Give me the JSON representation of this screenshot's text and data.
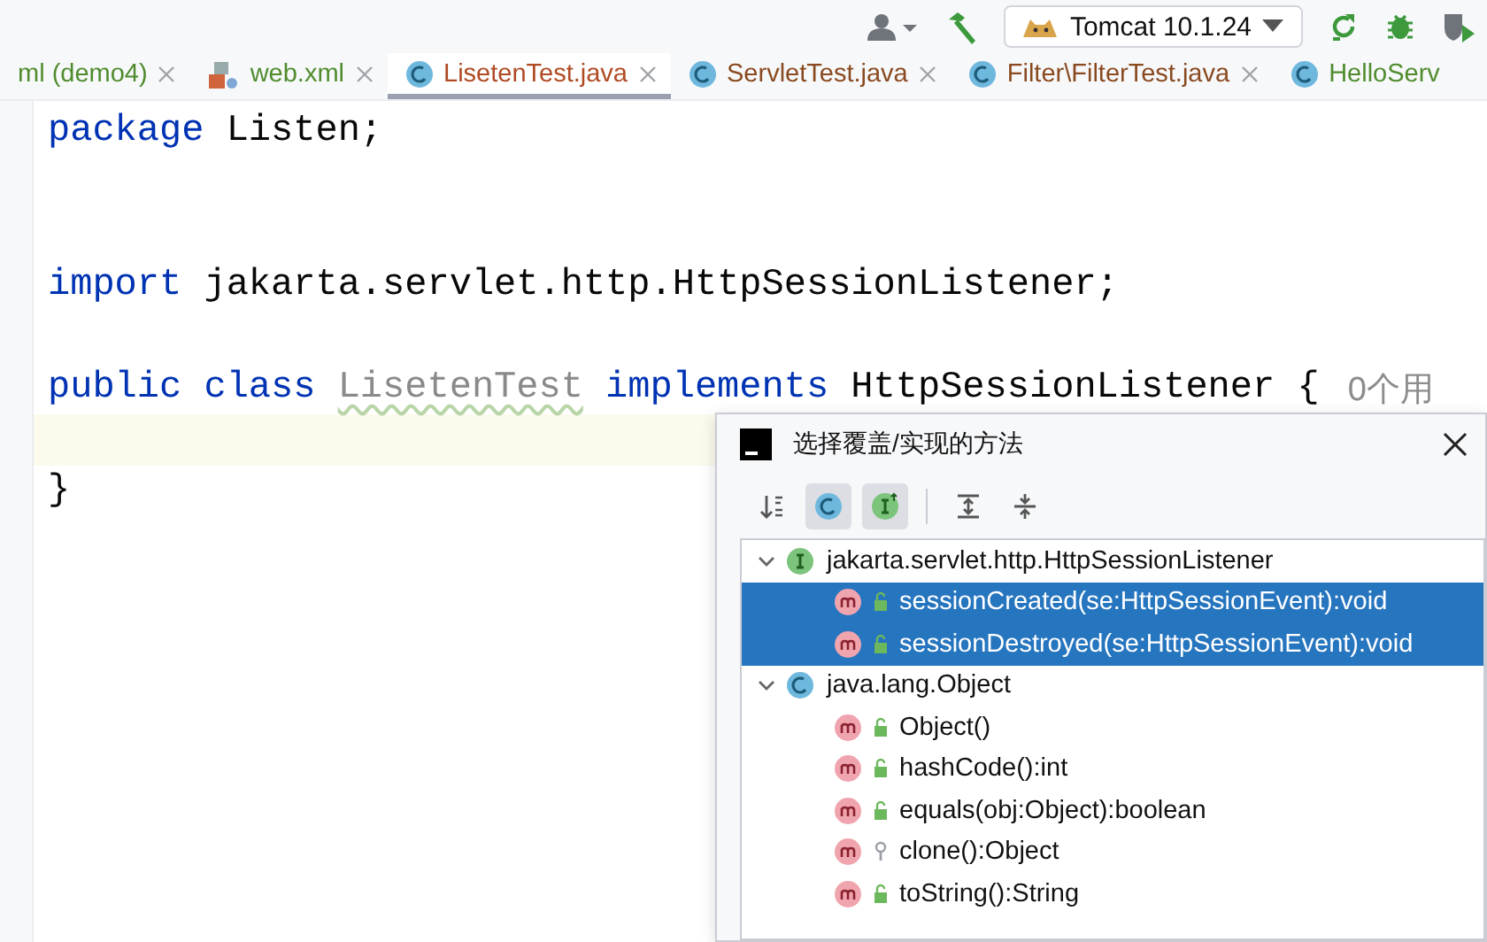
{
  "toolbar": {
    "run_config": "Tomcat 10.1.24"
  },
  "tabs": [
    {
      "label": "ml (demo4)",
      "kind": "xml-module",
      "color": "#508c2d",
      "selected": false
    },
    {
      "label": "web.xml",
      "kind": "xml",
      "color": "#508c2d",
      "selected": false
    },
    {
      "label": "LisetenTest.java",
      "kind": "class",
      "color": "#b04a24",
      "selected": true
    },
    {
      "label": "ServletTest.java",
      "kind": "class",
      "color": "#8a4a20",
      "selected": false
    },
    {
      "label": "Filter\\FilterTest.java",
      "kind": "class",
      "color": "#8a4a20",
      "selected": false
    },
    {
      "label": "HelloServ",
      "kind": "class",
      "color": "#508c2d",
      "selected": false
    }
  ],
  "editor": {
    "lines": [
      {
        "kind": "code",
        "tokens": [
          {
            "kind": "keyword",
            "text": "package"
          },
          {
            "kind": "plain",
            "text": "Listen;"
          }
        ]
      },
      {
        "kind": "blank"
      },
      {
        "kind": "blank"
      },
      {
        "kind": "code",
        "tokens": [
          {
            "kind": "keyword",
            "text": "import"
          },
          {
            "kind": "plain",
            "text": "jakarta.servlet.http.HttpSessionListener;"
          }
        ]
      },
      {
        "kind": "blank"
      },
      {
        "kind": "code",
        "tokens": [
          {
            "kind": "keyword",
            "text": "public"
          },
          {
            "kind": "keyword",
            "text": "class"
          },
          {
            "kind": "unused",
            "text": "LisetenTest"
          },
          {
            "kind": "keyword",
            "text": "implements"
          },
          {
            "kind": "plain",
            "text": "HttpSessionListener {"
          },
          {
            "kind": "hint",
            "text": "0个用"
          }
        ]
      },
      {
        "kind": "blank",
        "current": true
      },
      {
        "kind": "code",
        "tokens": [
          {
            "kind": "plain",
            "text": "}"
          }
        ]
      }
    ]
  },
  "dialog": {
    "title": "选择覆盖/实现的方法",
    "tools": [
      {
        "kind": "sort",
        "selected": false
      },
      {
        "kind": "class",
        "selected": true
      },
      {
        "kind": "interface",
        "selected": true
      },
      {
        "kind": "separator"
      },
      {
        "kind": "expand",
        "selected": false
      },
      {
        "kind": "collapse",
        "selected": false
      }
    ],
    "groups": [
      {
        "kind": "interface",
        "name": "jakarta.servlet.http.HttpSessionListener",
        "expanded": true,
        "children": [
          {
            "name": "sessionCreated(se:HttpSessionEvent):void",
            "protected": false,
            "selected": true
          },
          {
            "name": "sessionDestroyed(se:HttpSessionEvent):void",
            "protected": false,
            "selected": true
          }
        ]
      },
      {
        "kind": "class",
        "name": "java.lang.Object",
        "expanded": true,
        "children": [
          {
            "name": "Object()",
            "protected": false,
            "selected": false
          },
          {
            "name": "hashCode():int",
            "protected": false,
            "selected": false
          },
          {
            "name": "equals(obj:Object):boolean",
            "protected": false,
            "selected": false
          },
          {
            "name": "clone():Object",
            "protected": true,
            "selected": false
          },
          {
            "name": "toString():String",
            "protected": false,
            "selected": false
          }
        ]
      }
    ]
  }
}
